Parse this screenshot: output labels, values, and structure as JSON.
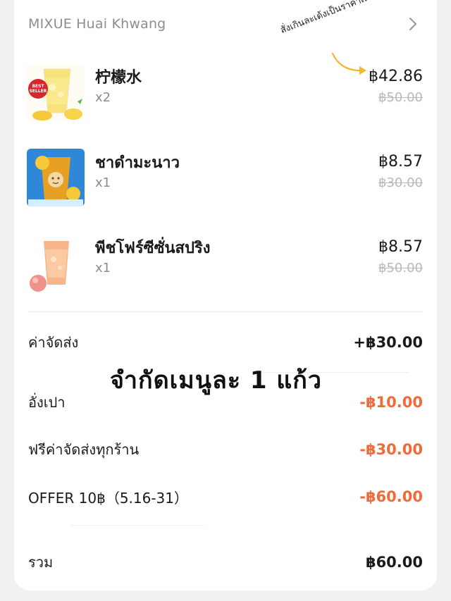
{
  "store": {
    "name": "MIXUE Huai Khwang"
  },
  "items": [
    {
      "name": "柠檬水",
      "qty": "x2",
      "price": "฿42.86",
      "original_price": "฿50.00",
      "badge": "BEST SELLER"
    },
    {
      "name": "ชาดำมะนาว",
      "qty": "x1",
      "price": "฿8.57",
      "original_price": "฿30.00"
    },
    {
      "name": "พีชโฟร์ซีซั่นสปริง",
      "qty": "x1",
      "price": "฿8.57",
      "original_price": "฿50.00"
    }
  ],
  "fees": [
    {
      "label": "ค่าจัดส่ง",
      "value": "+฿30.00"
    },
    {
      "label": "อั่งเปา",
      "value": "-฿10.00"
    },
    {
      "label": "ฟรีค่าจัดส่งทุกร้าน",
      "value": "-฿30.00"
    },
    {
      "label": "OFFER 10฿（5.16-31）",
      "value": "-฿60.00"
    }
  ],
  "total": {
    "label": "รวม",
    "value": "฿60.00"
  },
  "annotations": {
    "main": "จำกัดเมนูละ 1 แก้ว",
    "note": "สั่งเกินละเด้งเป็นราคาเต็ม"
  },
  "colors": {
    "discount": "#f06a3a",
    "muted": "#8d8d8d",
    "strikethrough": "#b8b8b8",
    "note_arrow": "#f2b632"
  }
}
